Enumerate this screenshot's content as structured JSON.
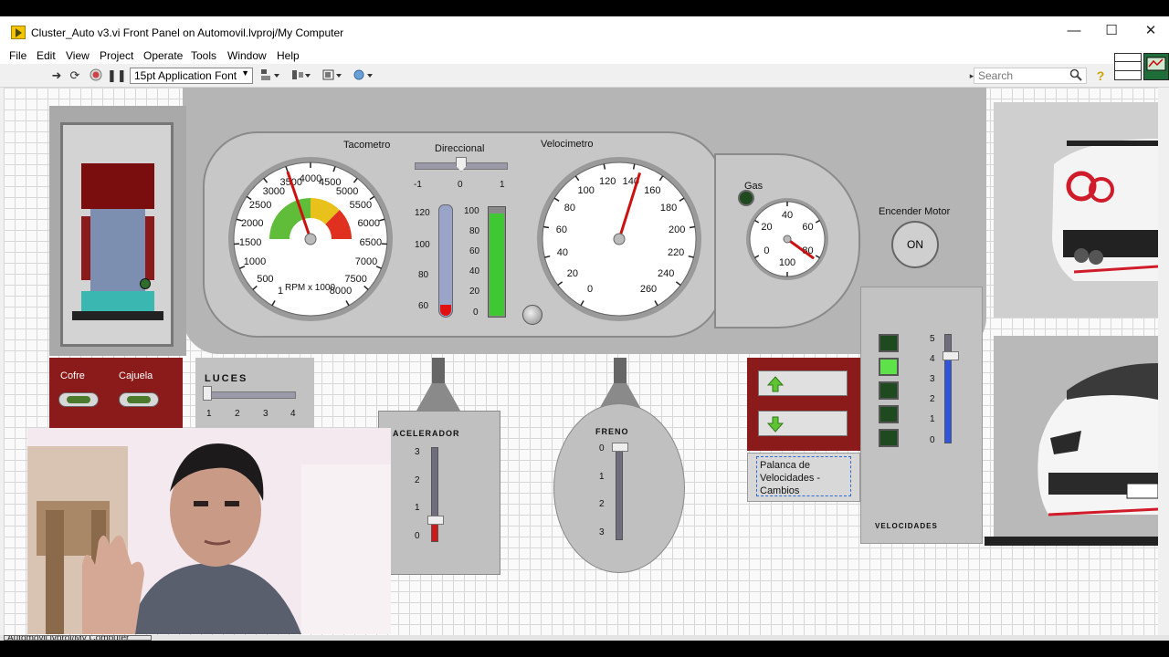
{
  "window": {
    "title": "Cluster_Auto v3.vi Front Panel on Automovil.lvproj/My Computer",
    "minimize": "—",
    "maximize": "☐",
    "close": "✕"
  },
  "menu": [
    "File",
    "Edit",
    "View",
    "Project",
    "Operate",
    "Tools",
    "Window",
    "Help"
  ],
  "toolbar": {
    "font": "15pt Application Font",
    "search_placeholder": "Search"
  },
  "labels": {
    "tacometro": "Tacometro",
    "velocimetro": "Velocimetro",
    "direccional": "Direccional",
    "gas": "Gas",
    "encender_motor": "Encender Motor",
    "on": "ON",
    "cofre": "Cofre",
    "cajuela": "Cajuela",
    "luces": "LUCES",
    "acelerador": "ACELERADOR",
    "freno": "FRENO",
    "palanca": "Palanca de Velocidades - Cambios",
    "velocidades": "VELOCIDADES",
    "rpm_unit": "RPM x 1000"
  },
  "tacometro": {
    "ticks": [
      "1",
      "500",
      "1000",
      "1500",
      "2000",
      "2500",
      "3000",
      "3500",
      "4000",
      "4500",
      "5000",
      "5500",
      "6000",
      "6500",
      "7000",
      "7500",
      "8000"
    ],
    "min": 1,
    "max": 8000,
    "value": 3500
  },
  "velocimetro": {
    "ticks": [
      "0",
      "20",
      "40",
      "60",
      "80",
      "100",
      "120",
      "140",
      "160",
      "180",
      "200",
      "220",
      "240",
      "260"
    ],
    "min": 0,
    "max": 260,
    "value": 145
  },
  "gas": {
    "ticks": [
      "0",
      "20",
      "40",
      "60",
      "80",
      "100"
    ],
    "value": 82
  },
  "direccional": {
    "ticks": [
      "-1",
      "0",
      "1"
    ],
    "value": 0
  },
  "thermometer": {
    "ticks": [
      "120",
      "100",
      "80",
      "60"
    ],
    "value": 60
  },
  "tank": {
    "ticks": [
      "100",
      "80",
      "60",
      "40",
      "20",
      "0"
    ],
    "value": 95
  },
  "luces": {
    "ticks": [
      "1",
      "2",
      "3",
      "4"
    ],
    "value": 1
  },
  "acelerador": {
    "ticks": [
      "3",
      "2",
      "1",
      "0"
    ],
    "value": 0.7
  },
  "freno": {
    "ticks": [
      "0",
      "1",
      "2",
      "3"
    ],
    "value": 0
  },
  "velocidades": {
    "ticks": [
      "5",
      "4",
      "3",
      "2",
      "1",
      "0"
    ],
    "value": 4,
    "leds": [
      false,
      true,
      false,
      false,
      false
    ]
  },
  "status": {
    "path": "Automovil.lvproj/My Computer"
  },
  "colors": {
    "panel_gray": "#b5b5b5",
    "dark_red": "#8b1a1a",
    "accent_red": "#e00000",
    "arrow_green": "#3e7a2a",
    "tank_green": "#3fc832",
    "slider_blue": "#2f55e0"
  }
}
